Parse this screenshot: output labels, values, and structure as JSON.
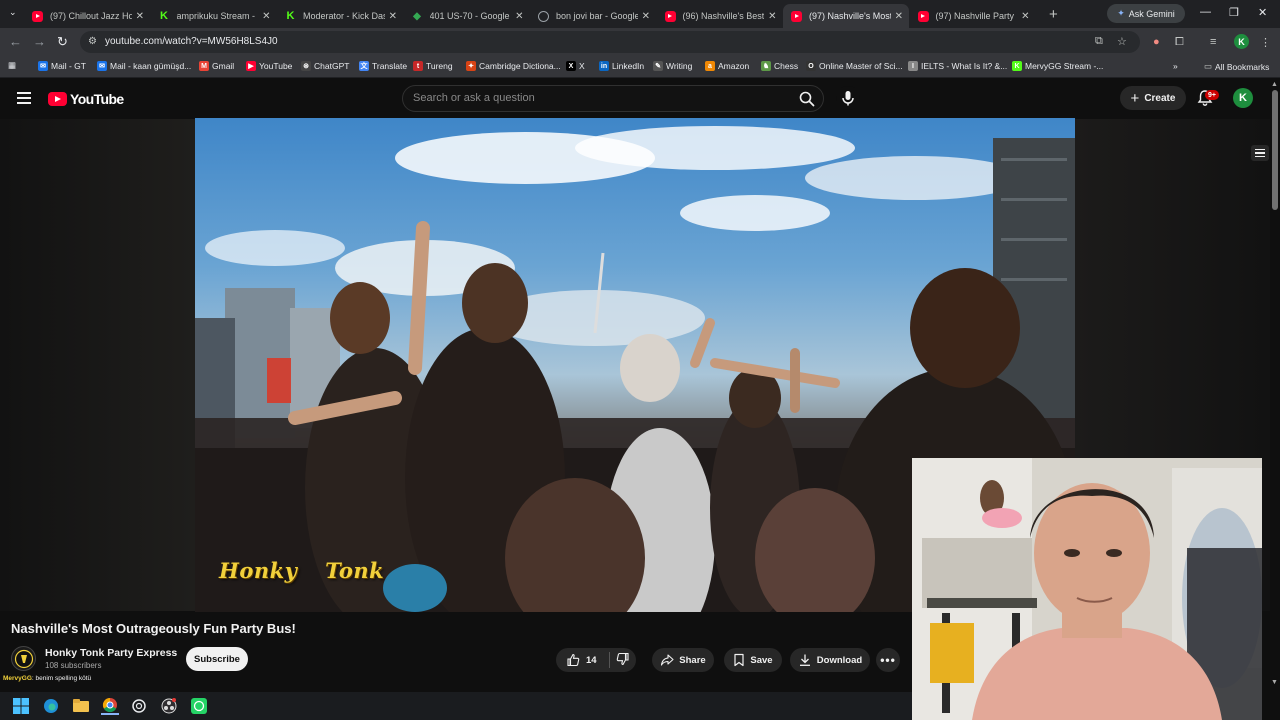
{
  "browser": {
    "tabs": [
      {
        "label": "(97) Chillout Jazz Hou",
        "favicon": "youtube-icon",
        "active": false
      },
      {
        "label": "amprikuku Stream - Ki",
        "favicon": "kick-icon",
        "active": false
      },
      {
        "label": "Moderator - Kick Dash",
        "favicon": "kick-icon",
        "active": false
      },
      {
        "label": "401 US-70 - Google M",
        "favicon": "google-maps-icon",
        "active": false
      },
      {
        "label": "bon jovi bar - Google",
        "favicon": "google-icon",
        "active": false
      },
      {
        "label": "(96) Nashville's Best P",
        "favicon": "youtube-icon",
        "active": false
      },
      {
        "label": "(97) Nashville's Most O",
        "favicon": "youtube-icon",
        "active": true
      },
      {
        "label": "(97) Nashville Party Bu",
        "favicon": "youtube-icon",
        "active": false
      }
    ],
    "ask_gemini_label": "Ask Gemini",
    "url": "youtube.com/watch?v=MW56H8LS4J0",
    "profile_initial": "K",
    "bookmarks": [
      {
        "label": "Mail - GT",
        "icon": "mail-icon",
        "color": "#1a73e8"
      },
      {
        "label": "Mail - kaan gümüşd...",
        "icon": "mail-icon",
        "color": "#1a73e8"
      },
      {
        "label": "Gmail",
        "icon": "gmail-icon",
        "color": "#ea4335"
      },
      {
        "label": "YouTube",
        "icon": "youtube-icon",
        "color": "#ff0033"
      },
      {
        "label": "ChatGPT",
        "icon": "chatgpt-icon",
        "color": "#444"
      },
      {
        "label": "Translate",
        "icon": "translate-icon",
        "color": "#4285f4"
      },
      {
        "label": "Tureng",
        "icon": "tureng-icon",
        "color": "#c62828"
      },
      {
        "label": "Cambridge Dictiona...",
        "icon": "cambridge-icon",
        "color": "#d84315"
      },
      {
        "label": "X",
        "icon": "x-icon",
        "color": "#000"
      },
      {
        "label": "LinkedIn",
        "icon": "linkedin-icon",
        "color": "#0a66c2"
      },
      {
        "label": "Writing",
        "icon": "writing-icon",
        "color": "#555"
      },
      {
        "label": "Amazon",
        "icon": "amazon-icon",
        "color": "#f08804"
      },
      {
        "label": "Chess",
        "icon": "chess-icon",
        "color": "#5d9948"
      },
      {
        "label": "Online Master of Sci...",
        "icon": "omsc-icon",
        "color": "#333"
      },
      {
        "label": "IELTS - What Is It? &...",
        "icon": "ielts-icon",
        "color": "#888"
      },
      {
        "label": "MervyGG Stream -...",
        "icon": "kick-icon",
        "color": "#53fc18"
      }
    ],
    "all_bookmarks_label": "All Bookmarks"
  },
  "youtube": {
    "logo_text": "YouTube",
    "search_placeholder": "Search or ask a question",
    "create_label": "Create",
    "notification_count": "9+",
    "avatar_initial": "K"
  },
  "video": {
    "caption_text": "Honky Tonk",
    "title": "Nashville's Most Outrageously Fun Party Bus!",
    "channel_name": "Honky Tonk Party Express",
    "subscribers": "108 subscribers",
    "subscribe_label": "Subscribe",
    "like_count": "14",
    "share_label": "Share",
    "save_label": "Save",
    "download_label": "Download"
  },
  "stream_chat": {
    "user": "MervyGG",
    "message": ": benim spelling kötü"
  },
  "colors": {
    "youtube_red": "#ff0033",
    "caption_yellow": "#f1d03b",
    "background": "#0f0f0f",
    "pill_bg": "#272727"
  }
}
